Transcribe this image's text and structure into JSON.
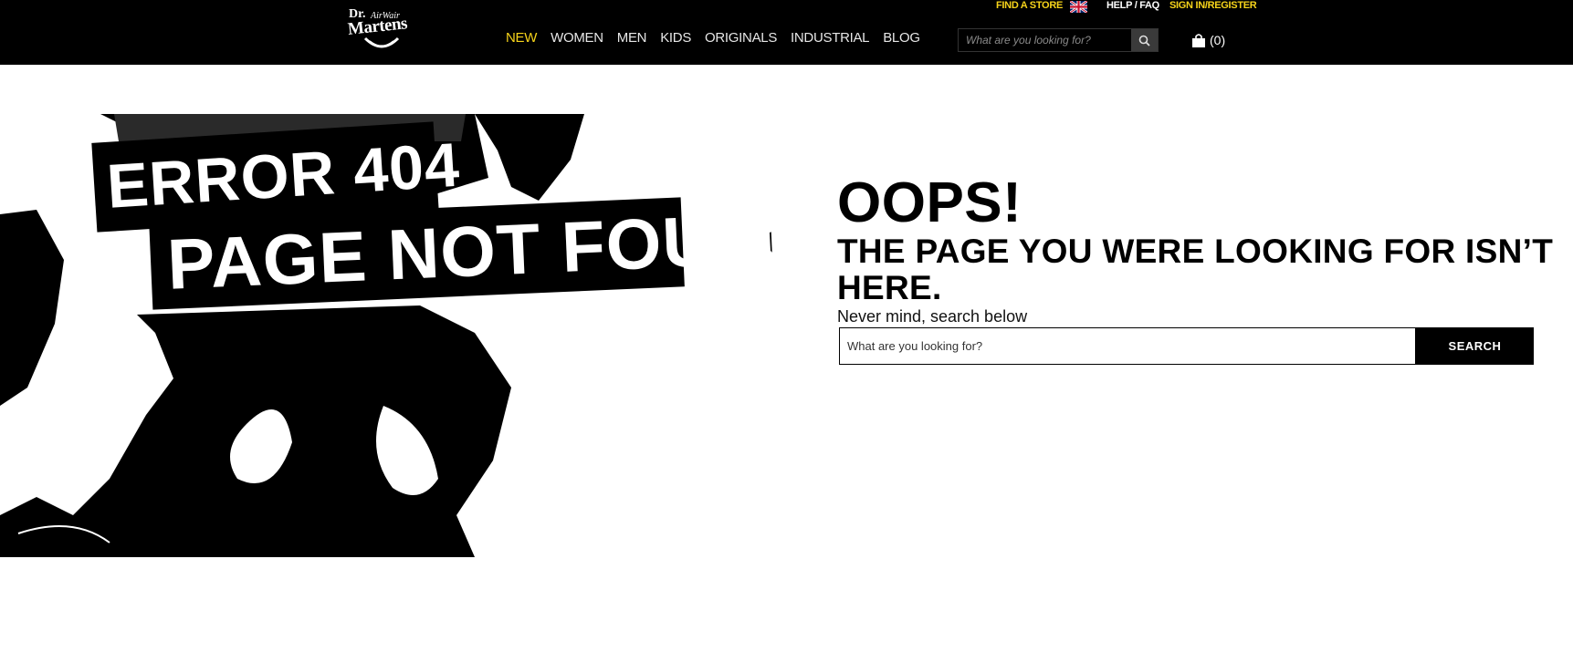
{
  "header": {
    "logo": {
      "dr": "Dr.",
      "airwair": "AirWair",
      "martens": "Martens"
    },
    "nav": [
      "NEW",
      "WOMEN",
      "MEN",
      "KIDS",
      "ORIGINALS",
      "INDUSTRIAL",
      "BLOG"
    ],
    "active_nav": "NEW",
    "util": {
      "find_store": "FIND A STORE",
      "help": "HELP / FAQ",
      "sign_in": "SIGN IN/REGISTER",
      "region_flag": "uk-flag-icon"
    },
    "search": {
      "placeholder": "What are you looking for?",
      "icon": "search-icon"
    },
    "cart": {
      "icon": "shopping-bag-icon",
      "count": "(0)"
    }
  },
  "hero": {
    "line1": "ERROR 404",
    "line2": "PAGE NOT FOUND"
  },
  "main": {
    "title": "OOPS!",
    "subtitle": "THE PAGE YOU WERE LOOKING FOR ISN’T HERE.",
    "tagline": "Never mind, search below",
    "search_placeholder": "What are you looking for?",
    "search_button": "SEARCH"
  },
  "colors": {
    "header_bg": "#000000",
    "accent_yellow": "#f6d31a",
    "text": "#000000",
    "page_bg": "#ffffff"
  }
}
